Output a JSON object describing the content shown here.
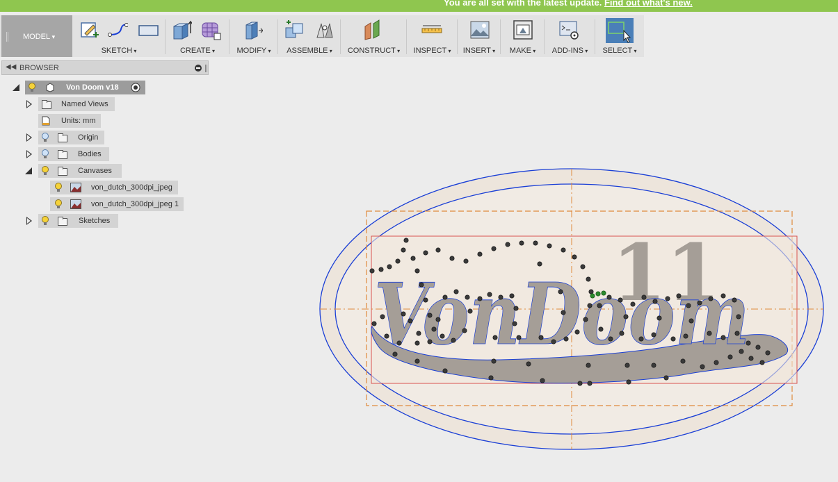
{
  "banner": {
    "message": "You are all set with the latest update.",
    "link": "Find out what's new."
  },
  "toolbar": {
    "workspace": "MODEL",
    "groups": [
      {
        "label": "SKETCH"
      },
      {
        "label": "CREATE"
      },
      {
        "label": "MODIFY"
      },
      {
        "label": "ASSEMBLE"
      },
      {
        "label": "CONSTRUCT"
      },
      {
        "label": "INSPECT"
      },
      {
        "label": "INSERT"
      },
      {
        "label": "MAKE"
      },
      {
        "label": "ADD-INS"
      },
      {
        "label": "SELECT"
      }
    ]
  },
  "browser": {
    "title": "BROWSER",
    "root": "Von Doom v18",
    "items": [
      {
        "label": "Named Views"
      },
      {
        "label": "Units: mm"
      },
      {
        "label": "Origin"
      },
      {
        "label": "Bodies"
      },
      {
        "label": "Canvases"
      },
      {
        "label": "von_dutch_300dpi_jpeg"
      },
      {
        "label": "von_dutch_300dpi_jpeg 1"
      },
      {
        "label": "Sketches"
      }
    ]
  },
  "canvas": {
    "logo_text": "VonDoom",
    "logo_number": "11",
    "colors": {
      "sketch_line": "#1a3fd6",
      "construction": "#e08a3c",
      "frame": "#d9534f",
      "fill": "#efe4d9",
      "text_fill": "#a59e97"
    }
  }
}
